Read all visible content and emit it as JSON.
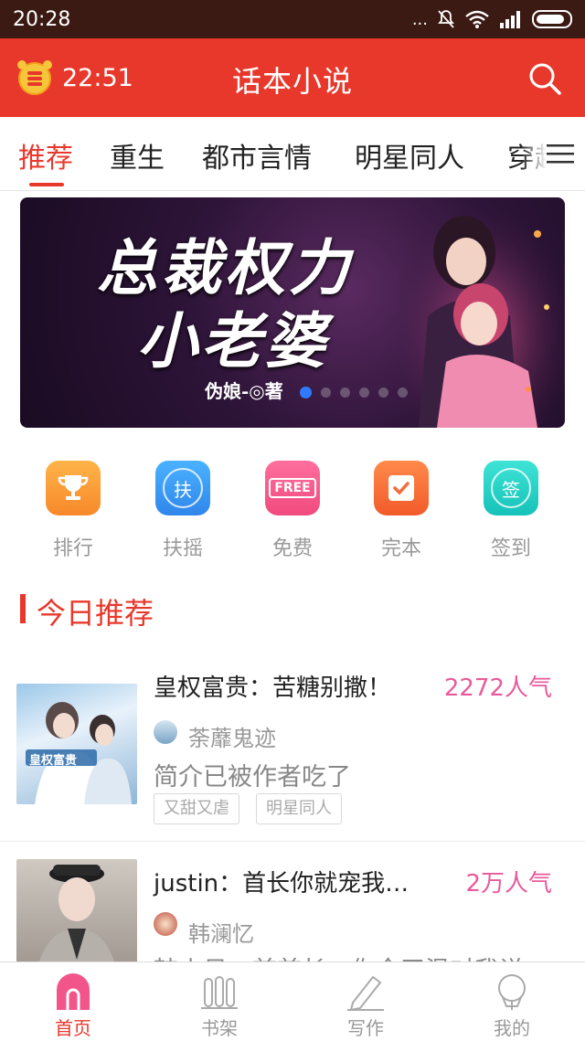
{
  "status_bar": {
    "time": "20:28",
    "dots": "..."
  },
  "app_bar": {
    "timer": "22:51",
    "title": "话本小说"
  },
  "tabs": [
    "推荐",
    "重生",
    "都市言情",
    "明星同人",
    "穿越"
  ],
  "banner": {
    "title_line1": "总裁权力",
    "title_line2": "小老婆",
    "author": "伪娘-◎著",
    "pages": 6,
    "active_page": 1
  },
  "quick_actions": [
    {
      "label": "排行",
      "icon": "trophy-icon",
      "color": "#f79a3c"
    },
    {
      "label": "扶摇",
      "icon": "fuyao-icon",
      "glyph": "扶",
      "color": "#3a9cf2"
    },
    {
      "label": "免费",
      "icon": "free-icon",
      "glyph": "FREE",
      "color": "#f2558a"
    },
    {
      "label": "完本",
      "icon": "completed-icon",
      "color": "#f46a3a"
    },
    {
      "label": "签到",
      "icon": "checkin-icon",
      "glyph": "签",
      "color": "#1fcfc2"
    }
  ],
  "section": {
    "title": "今日推荐"
  },
  "books": [
    {
      "title": "皇权富贵：苦糖别撒！",
      "popularity": "2272人气",
      "author": "荼蘼鬼迹",
      "desc": "简介已被作者吃了",
      "tags": [
        "又甜又虐",
        "明星同人"
      ],
      "cover_text": "皇权富贵"
    },
    {
      "title": "justin：首长你就宠我…",
      "popularity": "2万人气",
      "author": "韩澜忆",
      "desc": "韩小贝：首首长，你今天温对我说..."
    }
  ],
  "bottom_nav": [
    {
      "label": "首页",
      "icon": "home-icon",
      "active": true
    },
    {
      "label": "书架",
      "icon": "bookshelf-icon",
      "active": false
    },
    {
      "label": "写作",
      "icon": "write-icon",
      "active": false
    },
    {
      "label": "我的",
      "icon": "profile-icon",
      "active": false
    }
  ],
  "colors": {
    "accent": "#e8382b",
    "popularity": "#e85a9b",
    "status_bar": "#3a1a12"
  }
}
